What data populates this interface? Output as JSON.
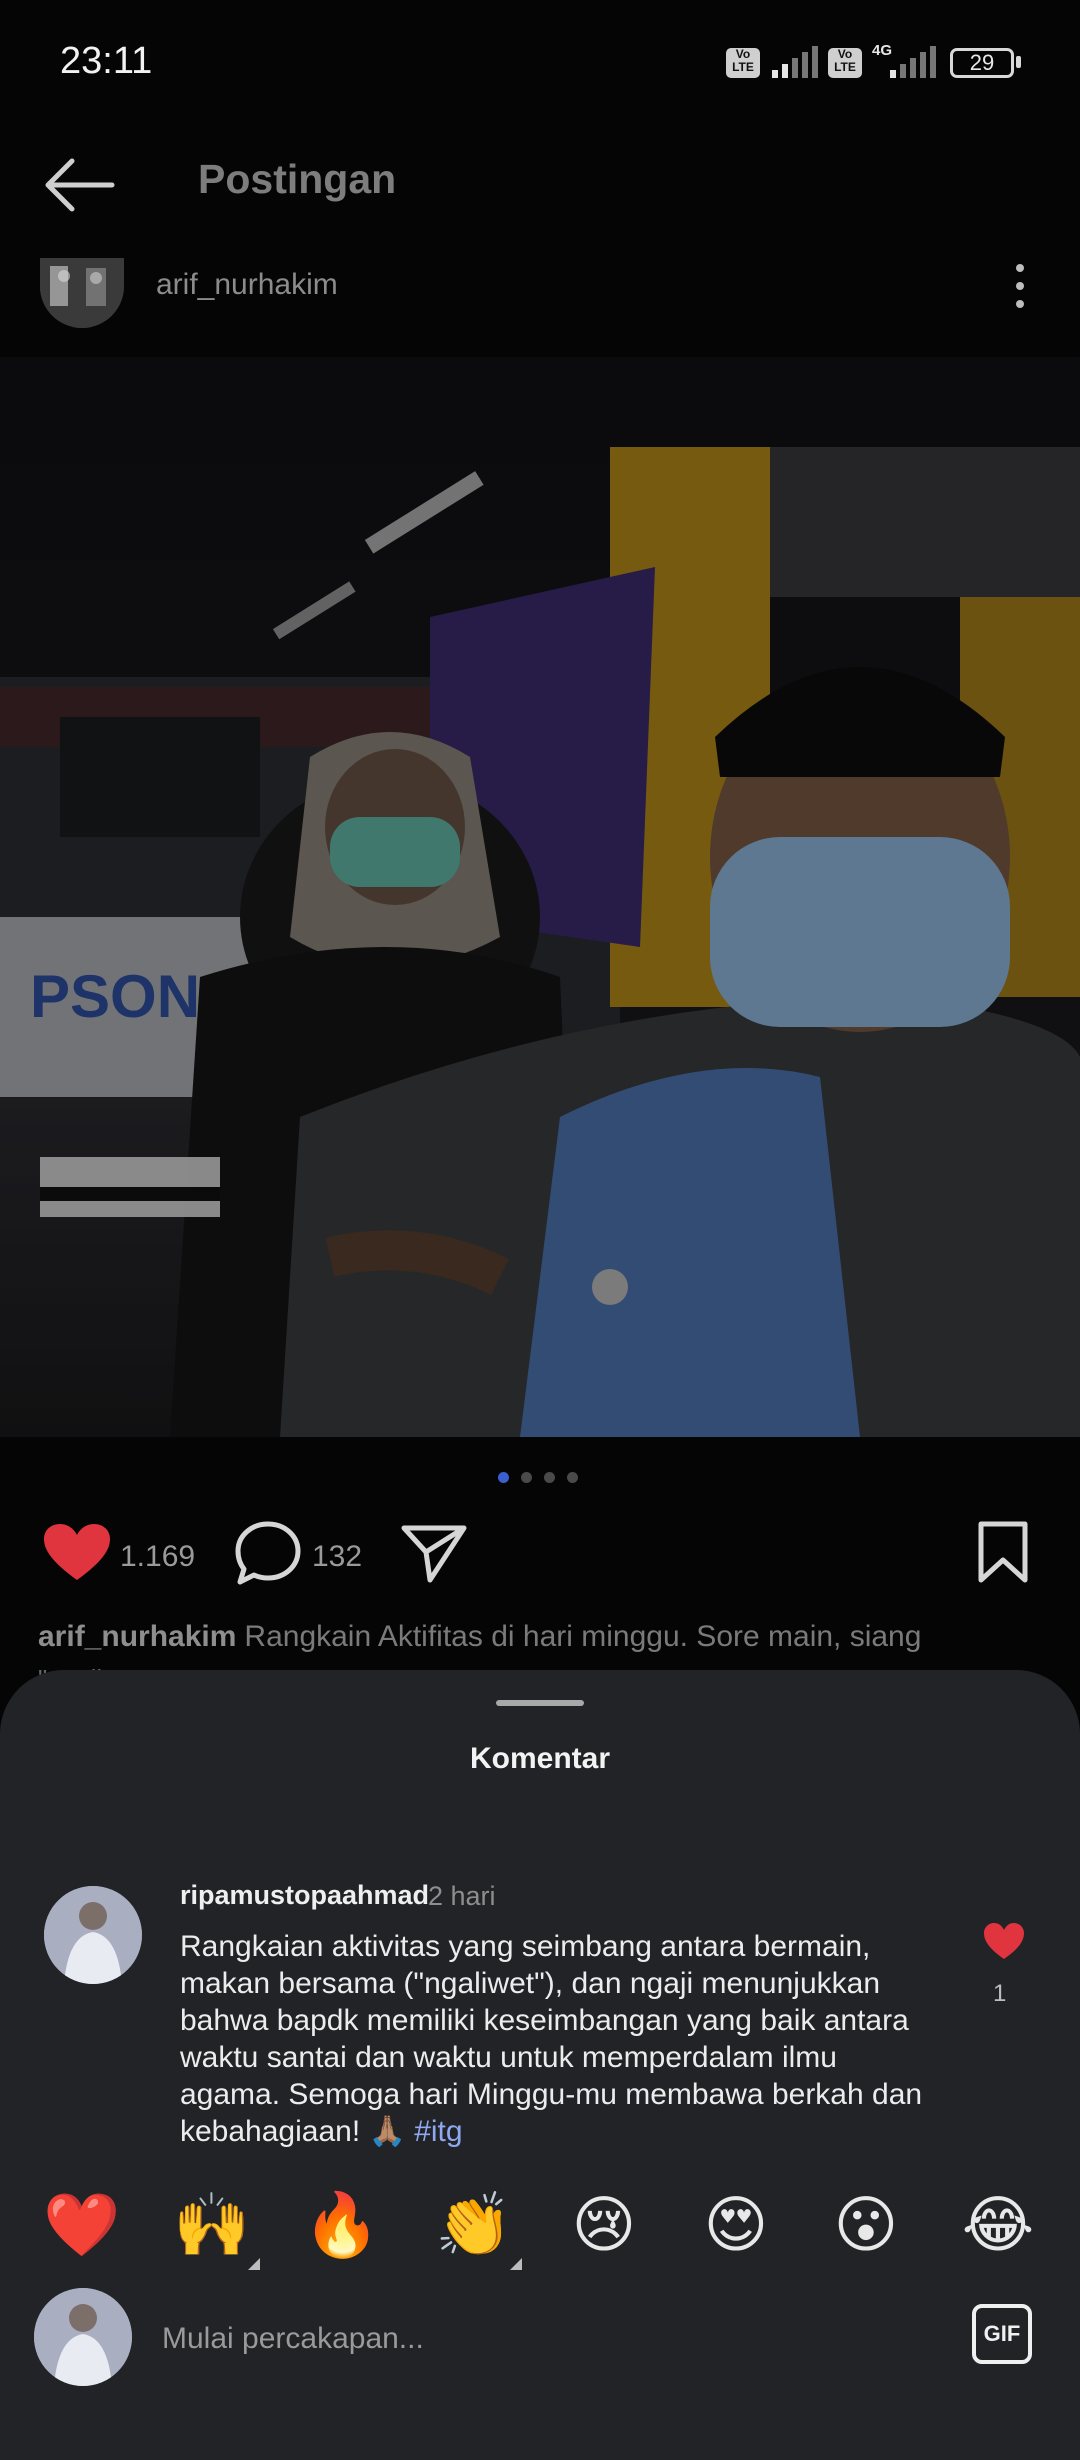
{
  "status_bar": {
    "time": "23:11",
    "badges": [
      "Vo LTE",
      "Vo LTE"
    ],
    "network": "4G",
    "battery": "29"
  },
  "header": {
    "title": "Postingan"
  },
  "post": {
    "username": "arif_nurhakim",
    "like_count": "1.169",
    "comment_count": "132",
    "caption_user": "arif_nurhakim",
    "caption_text": "Rangkain Aktifitas di hari minggu. Sore main, siang",
    "caption_peek": "\"ngaliwet\"",
    "carousel_pages": 4,
    "carousel_active_index": 0
  },
  "comments_sheet": {
    "title": "Komentar",
    "comment": {
      "username": "ripamustopaahmad",
      "time": "2 hari",
      "text": "Rangkaian aktivitas yang seimbang antara bermain, makan bersama (\"ngaliwet\"), dan ngaji menunjukkan bahwa bapdk memiliki keseimbangan yang baik antara waktu santai dan waktu untuk memperdalam ilmu agama. Semoga hari Minggu-mu membawa berkah dan kebahagiaan! 🙏🏽",
      "hashtag": "#itg",
      "like_count": "1"
    },
    "emoji_bar": [
      "❤️",
      "🙌",
      "🔥",
      "👏",
      "😢",
      "😍",
      "😮",
      "😂"
    ],
    "input_placeholder": "Mulai percakapan...",
    "gif_label": "GIF"
  },
  "colors": {
    "background": "#050505",
    "sheet": "#212327",
    "like_red": "#e0343f",
    "hashtag": "#8fa8f0",
    "carousel_active": "#3b5fd0"
  }
}
